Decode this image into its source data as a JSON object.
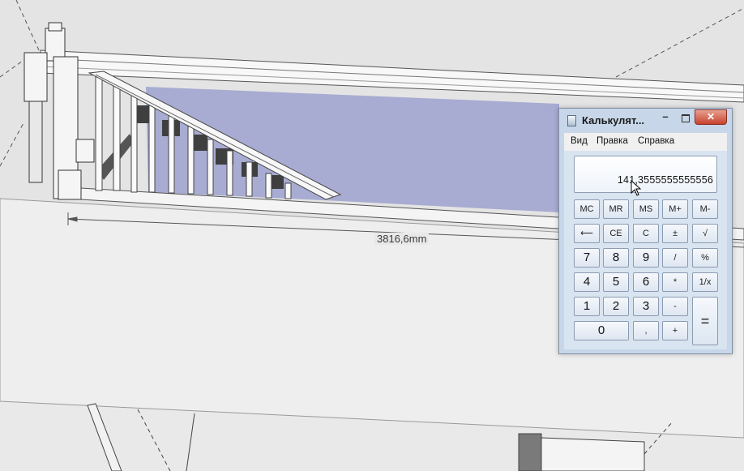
{
  "viewport": {
    "dimension_label": "3816,6mm",
    "colors": {
      "background": "#e6e6e6",
      "floor": "#ededed",
      "glass": "#a7abd0",
      "rail": "#f7f7f7"
    }
  },
  "calculator": {
    "title": "Калькулят...",
    "window_buttons": {
      "minimize": "–",
      "close": "✕"
    },
    "menu": [
      "Вид",
      "Правка",
      "Справка"
    ],
    "display_value": "141,3555555555556",
    "keys": {
      "row1": [
        "MC",
        "MR",
        "MS",
        "M+",
        "M-"
      ],
      "row2": [
        "⟵",
        "CE",
        "C",
        "±",
        "√"
      ],
      "row3": [
        "7",
        "8",
        "9",
        "/",
        "%"
      ],
      "row4": [
        "4",
        "5",
        "6",
        "*",
        "1/x"
      ],
      "row5": [
        "1",
        "2",
        "3",
        "-"
      ],
      "row6": [
        "0",
        ",",
        "+"
      ],
      "equals": "="
    }
  }
}
